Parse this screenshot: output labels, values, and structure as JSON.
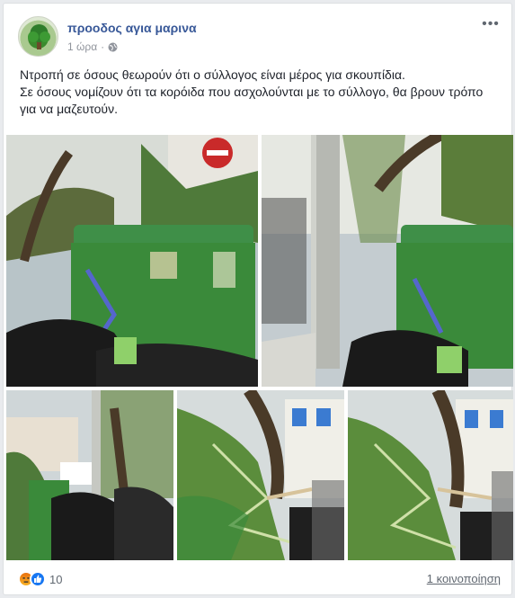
{
  "post": {
    "page_name": "προοδος αγια μαρινα",
    "time": "1 ώρα",
    "dot": "·",
    "more_icon": "more-horizontal-icon",
    "globe_icon": "globe-icon",
    "text_line1": "Ντροπή σε όσους θεωρούν ότι ο σύλλογος είναι μέρος για σκουπίδια.",
    "text_line2": "Σε όσους νομίζουν ότι τα κορόιδα που ασχολούνται με το σύλλογο, θα βρουν τρόπο για να μαζευτούν."
  },
  "photos": [
    {
      "subject": "green dumpster with garbage bags and no-entry sign"
    },
    {
      "subject": "concrete pole beside green dumpster and garbage bags"
    },
    {
      "subject": "green dumpster beside pole with piled garbage bags"
    },
    {
      "subject": "tree branches piled by dumpster"
    },
    {
      "subject": "tree branches piled by dumpster close-up"
    }
  ],
  "footer": {
    "reaction_icons": [
      "angry-icon",
      "like-icon"
    ],
    "reaction_count": "10",
    "shares": "1 κοινοποίηση"
  },
  "colors": {
    "link_blue": "#385898",
    "meta_gray": "#90949c",
    "dumpster_green": "#3a8a3a",
    "background": "#e9ebee"
  }
}
